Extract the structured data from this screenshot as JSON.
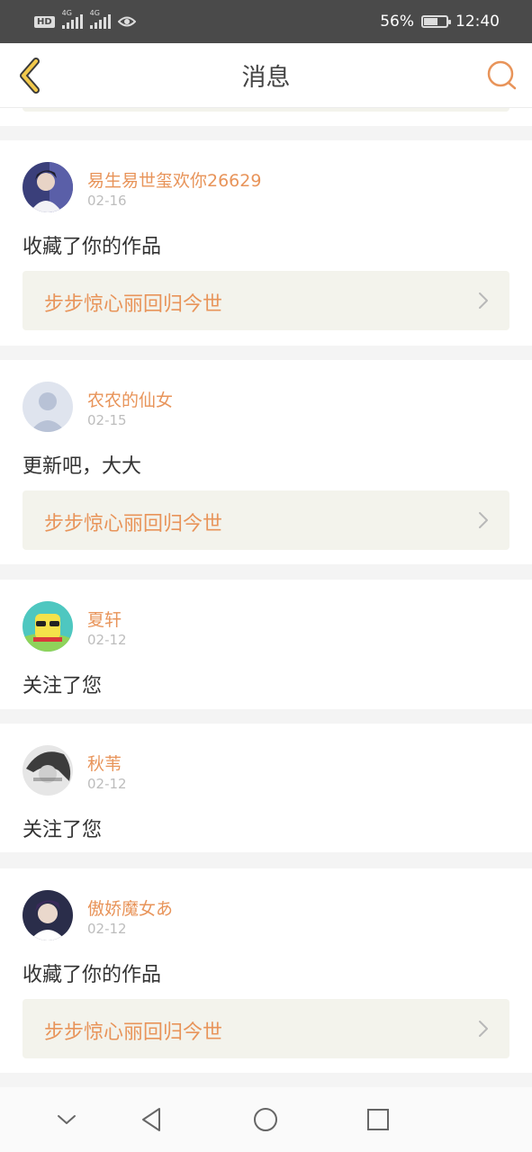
{
  "status_bar": {
    "hd": "HD",
    "net1": "4G",
    "net2": "4G",
    "battery": "56%",
    "time": "12:40"
  },
  "nav": {
    "title": "消息"
  },
  "messages": [
    {
      "user": "易生易世玺欢你26629",
      "date": "02-16",
      "action": "收藏了你的作品",
      "work": "步步惊心丽回归今世"
    },
    {
      "user": "农农的仙女",
      "date": "02-15",
      "action": "更新吧，大大",
      "work": "步步惊心丽回归今世"
    },
    {
      "user": "夏轩",
      "date": "02-12",
      "action": "关注了您"
    },
    {
      "user": "秋苇",
      "date": "02-12",
      "action": "关注了您"
    },
    {
      "user": "傲娇魔女あ",
      "date": "02-12",
      "action": "收藏了你的作品",
      "work": "步步惊心丽回归今世"
    }
  ],
  "colors": {
    "accent": "#e8945a",
    "back_icon": "#f2c94c",
    "work_bg": "#f3f3ec"
  },
  "icons": {
    "back": "chevron-left-icon",
    "search": "search-icon",
    "work_arrow": "chevron-right-icon",
    "nav_hide": "chevron-down-icon",
    "nav_back": "triangle-back-icon",
    "nav_home": "circle-home-icon",
    "nav_recents": "square-recents-icon"
  }
}
